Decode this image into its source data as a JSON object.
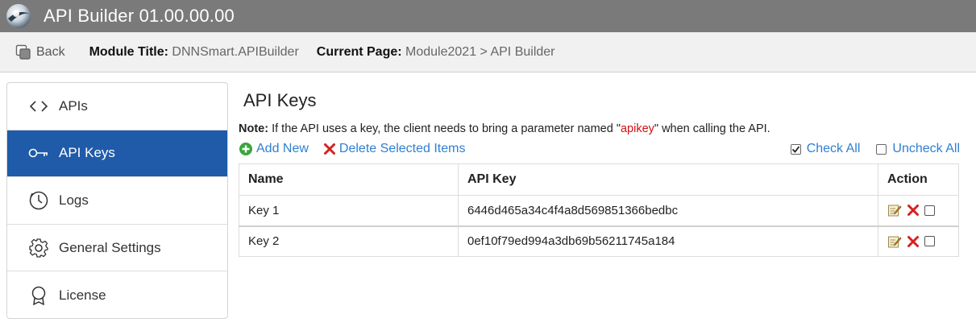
{
  "titlebar": {
    "title": "API Builder 01.00.00.00"
  },
  "toolbar": {
    "back_label": "Back",
    "module_title_label": "Module Title:",
    "module_title_value": "DNNSmart.APIBuilder",
    "current_page_label": "Current Page:",
    "current_page_value": "Module2021 > API Builder"
  },
  "sidebar": {
    "items": [
      {
        "label": "APIs",
        "icon": "code-icon",
        "active": false
      },
      {
        "label": "API Keys",
        "icon": "key-icon",
        "active": true
      },
      {
        "label": "Logs",
        "icon": "clock-icon",
        "active": false
      },
      {
        "label": "General Settings",
        "icon": "gear-icon",
        "active": false
      },
      {
        "label": "License",
        "icon": "award-icon",
        "active": false
      }
    ]
  },
  "main": {
    "heading": "API Keys",
    "note": {
      "label": "Note:",
      "text_before": " If the API uses a key, the client needs to bring a parameter named \"",
      "keyword": "apikey",
      "text_after": "\" when calling the API."
    },
    "actions": {
      "add_new": "Add New",
      "delete_selected": "Delete Selected Items",
      "check_all": "Check All",
      "uncheck_all": "Uncheck All"
    },
    "table": {
      "columns": [
        "Name",
        "API Key",
        "Action"
      ],
      "rows": [
        {
          "name": "Key 1",
          "api_key": "6446d465a34c4f4a8d569851366bedbc"
        },
        {
          "name": "Key 2",
          "api_key": "0ef10f79ed994a3db69b56211745a184"
        }
      ]
    }
  },
  "colors": {
    "titlebar": "#7a7a7a",
    "active_nav": "#1f5ba8",
    "link": "#2f7fd0",
    "keyword": "#cc1111",
    "delete_red": "#d62020",
    "add_green": "#3aa53a"
  }
}
